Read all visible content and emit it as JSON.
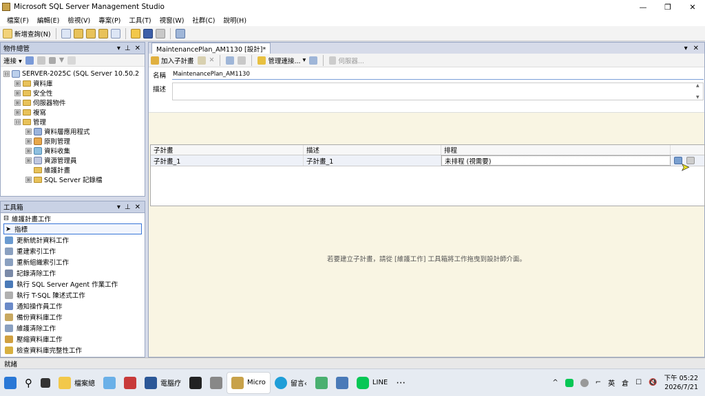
{
  "window": {
    "title": "Microsoft SQL Server Management Studio"
  },
  "menu": [
    "檔案(F)",
    "編輯(E)",
    "檢視(V)",
    "專案(P)",
    "工具(T)",
    "視窗(W)",
    "社群(C)",
    "說明(H)"
  ],
  "toolbar": {
    "new_query_label": "新增查詢(N)"
  },
  "object_explorer": {
    "title": "物件總管",
    "connect_label": "連接",
    "nodes": [
      {
        "label": "SERVER-2025C (SQL Server 10.50.2",
        "level": 0,
        "expander": "⊟"
      },
      {
        "label": "資料庫",
        "level": 1,
        "expander": "⊞"
      },
      {
        "label": "安全性",
        "level": 1,
        "expander": "⊞"
      },
      {
        "label": "伺服器物件",
        "level": 1,
        "expander": "⊞"
      },
      {
        "label": "複寫",
        "level": 1,
        "expander": "⊞"
      },
      {
        "label": "管理",
        "level": 1,
        "expander": "⊟"
      },
      {
        "label": "資料層應用程式",
        "level": 2,
        "expander": "⊞"
      },
      {
        "label": "原則管理",
        "level": 2,
        "expander": "⊞"
      },
      {
        "label": "資料收集",
        "level": 2,
        "expander": "⊞"
      },
      {
        "label": "資源管理員",
        "level": 2,
        "expander": "⊞"
      },
      {
        "label": "維護計畫",
        "level": 2,
        "expander": ""
      },
      {
        "label": "SQL Server 記錄檔",
        "level": 2,
        "expander": "⊞"
      }
    ]
  },
  "toolbox": {
    "title": "工具箱",
    "category": "維護計畫工作",
    "pointer_label": "指標",
    "items": [
      "更新統計資料工作",
      "重建索引工作",
      "重新組織索引工作",
      "記錄清除工作",
      "執行 SQL Server Agent 作業工作",
      "執行 T-SQL 陳述式工作",
      "通知操作員工作",
      "備份資料庫工作",
      "維護清除工作",
      "壓縮資料庫工作",
      "檢查資料庫完整性工作"
    ]
  },
  "document": {
    "tab_label": "MaintenancePlan_AM1130 [設計]*",
    "add_subplan_label": "加入子計畫",
    "manage_connections_label": "管理連接...",
    "servers_label": "伺服器...",
    "name_label": "名稱",
    "name_value": "MaintenancePlan_AM1130",
    "description_label": "描述",
    "grid": {
      "columns": [
        "子計畫",
        "描述",
        "排程"
      ],
      "rows": [
        [
          "子計畫_1",
          "子計畫_1",
          "未排程 (視需要)"
        ]
      ]
    },
    "hint": "若要建立子計畫，請從 [維護工作] 工具箱將工作拖曳到設計師介面。"
  },
  "status": {
    "text": "就緒"
  },
  "taskbar": {
    "items": [
      "檔案總",
      "電腦疗",
      "Micro",
      "留言‹",
      "LINE"
    ],
    "ime": "英",
    "ime2": "倉",
    "time": "下午 05:22",
    "date": "2026/7/21"
  }
}
